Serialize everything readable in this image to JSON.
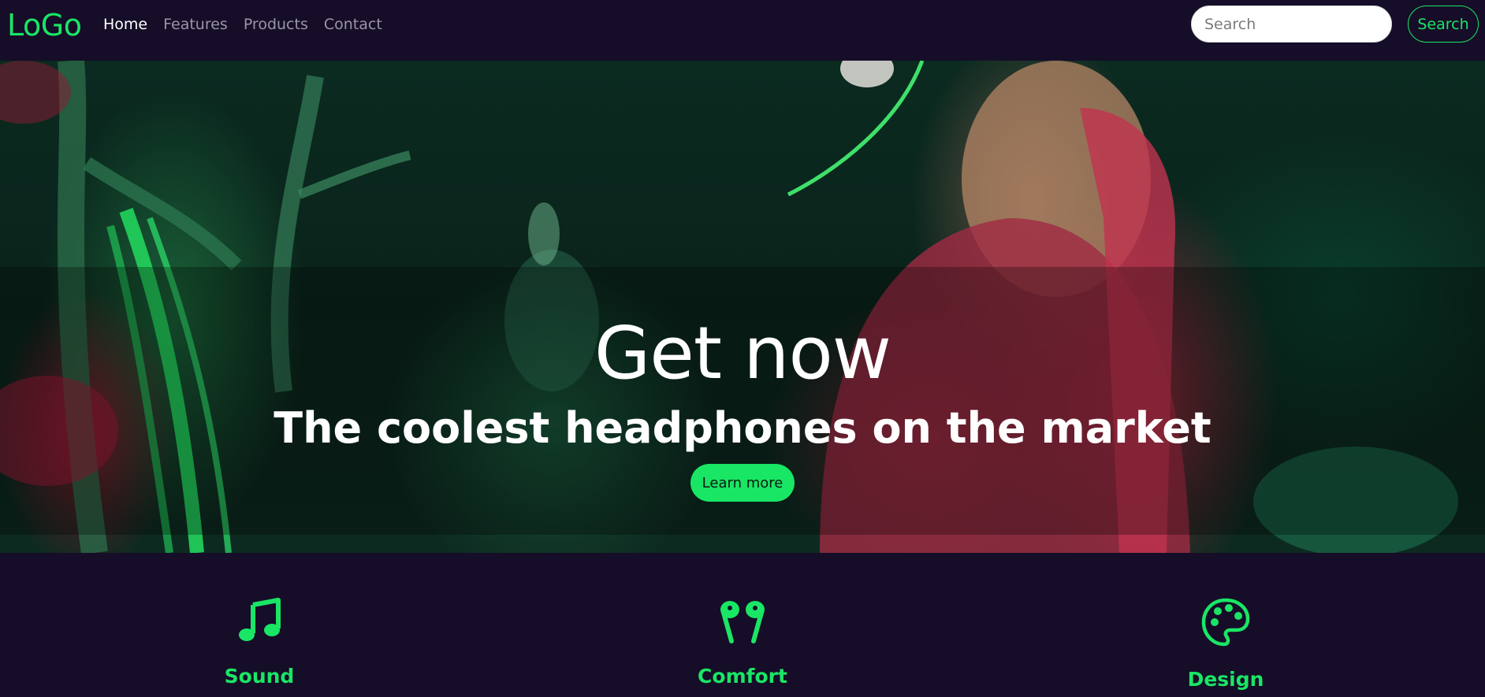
{
  "navbar": {
    "logo": "LoGo",
    "links": [
      {
        "label": "Home",
        "active": true
      },
      {
        "label": "Features",
        "active": false
      },
      {
        "label": "Products",
        "active": false
      },
      {
        "label": "Contact",
        "active": false
      }
    ],
    "search_placeholder": "Search",
    "search_button": "Search"
  },
  "hero": {
    "title": "Get now",
    "subtitle": "The coolest headphones on the market",
    "cta_label": "Learn more"
  },
  "features": [
    {
      "title": "Sound",
      "icon": "music-note-icon"
    },
    {
      "title": "Comfort",
      "icon": "earbuds-icon"
    },
    {
      "title": "Design",
      "icon": "palette-icon"
    }
  ],
  "colors": {
    "accent": "#19e665",
    "background": "#160d28",
    "nav_link": "#9a95a6"
  }
}
